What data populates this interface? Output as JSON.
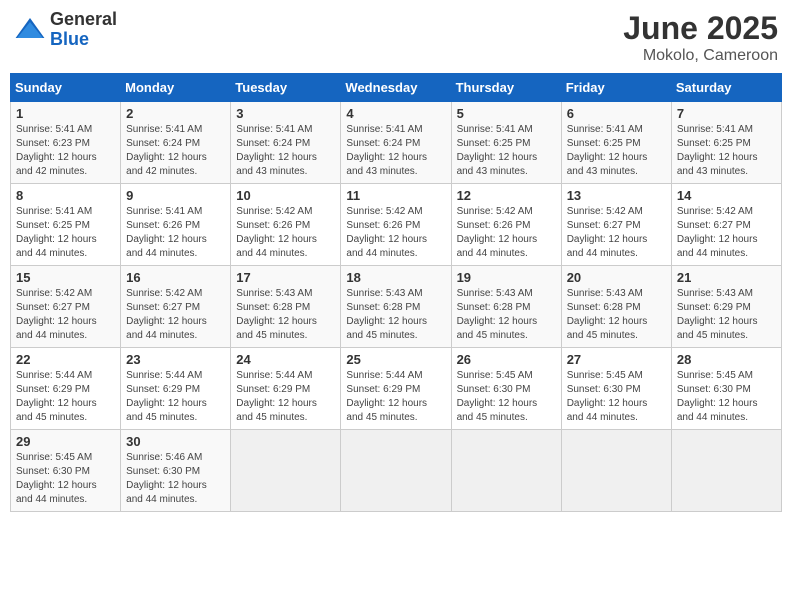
{
  "header": {
    "logo_general": "General",
    "logo_blue": "Blue",
    "month_title": "June 2025",
    "subtitle": "Mokolo, Cameroon"
  },
  "days_of_week": [
    "Sunday",
    "Monday",
    "Tuesday",
    "Wednesday",
    "Thursday",
    "Friday",
    "Saturday"
  ],
  "weeks": [
    [
      {
        "day": "1",
        "sunrise": "5:41 AM",
        "sunset": "6:23 PM",
        "daylight": "12 hours and 42 minutes."
      },
      {
        "day": "2",
        "sunrise": "5:41 AM",
        "sunset": "6:24 PM",
        "daylight": "12 hours and 42 minutes."
      },
      {
        "day": "3",
        "sunrise": "5:41 AM",
        "sunset": "6:24 PM",
        "daylight": "12 hours and 43 minutes."
      },
      {
        "day": "4",
        "sunrise": "5:41 AM",
        "sunset": "6:24 PM",
        "daylight": "12 hours and 43 minutes."
      },
      {
        "day": "5",
        "sunrise": "5:41 AM",
        "sunset": "6:25 PM",
        "daylight": "12 hours and 43 minutes."
      },
      {
        "day": "6",
        "sunrise": "5:41 AM",
        "sunset": "6:25 PM",
        "daylight": "12 hours and 43 minutes."
      },
      {
        "day": "7",
        "sunrise": "5:41 AM",
        "sunset": "6:25 PM",
        "daylight": "12 hours and 43 minutes."
      }
    ],
    [
      {
        "day": "8",
        "sunrise": "5:41 AM",
        "sunset": "6:25 PM",
        "daylight": "12 hours and 44 minutes."
      },
      {
        "day": "9",
        "sunrise": "5:41 AM",
        "sunset": "6:26 PM",
        "daylight": "12 hours and 44 minutes."
      },
      {
        "day": "10",
        "sunrise": "5:42 AM",
        "sunset": "6:26 PM",
        "daylight": "12 hours and 44 minutes."
      },
      {
        "day": "11",
        "sunrise": "5:42 AM",
        "sunset": "6:26 PM",
        "daylight": "12 hours and 44 minutes."
      },
      {
        "day": "12",
        "sunrise": "5:42 AM",
        "sunset": "6:26 PM",
        "daylight": "12 hours and 44 minutes."
      },
      {
        "day": "13",
        "sunrise": "5:42 AM",
        "sunset": "6:27 PM",
        "daylight": "12 hours and 44 minutes."
      },
      {
        "day": "14",
        "sunrise": "5:42 AM",
        "sunset": "6:27 PM",
        "daylight": "12 hours and 44 minutes."
      }
    ],
    [
      {
        "day": "15",
        "sunrise": "5:42 AM",
        "sunset": "6:27 PM",
        "daylight": "12 hours and 44 minutes."
      },
      {
        "day": "16",
        "sunrise": "5:42 AM",
        "sunset": "6:27 PM",
        "daylight": "12 hours and 44 minutes."
      },
      {
        "day": "17",
        "sunrise": "5:43 AM",
        "sunset": "6:28 PM",
        "daylight": "12 hours and 45 minutes."
      },
      {
        "day": "18",
        "sunrise": "5:43 AM",
        "sunset": "6:28 PM",
        "daylight": "12 hours and 45 minutes."
      },
      {
        "day": "19",
        "sunrise": "5:43 AM",
        "sunset": "6:28 PM",
        "daylight": "12 hours and 45 minutes."
      },
      {
        "day": "20",
        "sunrise": "5:43 AM",
        "sunset": "6:28 PM",
        "daylight": "12 hours and 45 minutes."
      },
      {
        "day": "21",
        "sunrise": "5:43 AM",
        "sunset": "6:29 PM",
        "daylight": "12 hours and 45 minutes."
      }
    ],
    [
      {
        "day": "22",
        "sunrise": "5:44 AM",
        "sunset": "6:29 PM",
        "daylight": "12 hours and 45 minutes."
      },
      {
        "day": "23",
        "sunrise": "5:44 AM",
        "sunset": "6:29 PM",
        "daylight": "12 hours and 45 minutes."
      },
      {
        "day": "24",
        "sunrise": "5:44 AM",
        "sunset": "6:29 PM",
        "daylight": "12 hours and 45 minutes."
      },
      {
        "day": "25",
        "sunrise": "5:44 AM",
        "sunset": "6:29 PM",
        "daylight": "12 hours and 45 minutes."
      },
      {
        "day": "26",
        "sunrise": "5:45 AM",
        "sunset": "6:30 PM",
        "daylight": "12 hours and 45 minutes."
      },
      {
        "day": "27",
        "sunrise": "5:45 AM",
        "sunset": "6:30 PM",
        "daylight": "12 hours and 44 minutes."
      },
      {
        "day": "28",
        "sunrise": "5:45 AM",
        "sunset": "6:30 PM",
        "daylight": "12 hours and 44 minutes."
      }
    ],
    [
      {
        "day": "29",
        "sunrise": "5:45 AM",
        "sunset": "6:30 PM",
        "daylight": "12 hours and 44 minutes."
      },
      {
        "day": "30",
        "sunrise": "5:46 AM",
        "sunset": "6:30 PM",
        "daylight": "12 hours and 44 minutes."
      },
      null,
      null,
      null,
      null,
      null
    ]
  ]
}
